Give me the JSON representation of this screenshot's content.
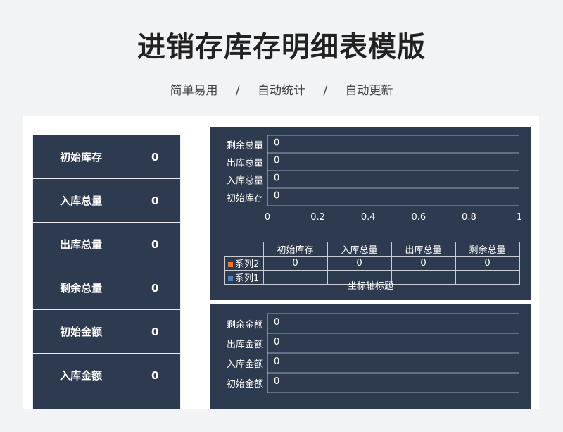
{
  "page": {
    "title": "进销存库存明细表模版",
    "tags": [
      "简单易用",
      "自动统计",
      "自动更新"
    ],
    "separator": "/"
  },
  "summary": {
    "rows": [
      {
        "label": "初始库存",
        "value": "0"
      },
      {
        "label": "入库总量",
        "value": "0"
      },
      {
        "label": "出库总量",
        "value": "0"
      },
      {
        "label": "剩余总量",
        "value": "0"
      },
      {
        "label": "初始金额",
        "value": "0"
      },
      {
        "label": "入库金额",
        "value": "0"
      }
    ]
  },
  "chart_data": [
    {
      "type": "bar",
      "orientation": "horizontal",
      "categories": [
        "初始库存",
        "入库总量",
        "出库总量",
        "剩余总量"
      ],
      "series": [
        {
          "name": "系列2",
          "values": [
            0,
            0,
            0,
            0
          ],
          "color": "#e07b39"
        },
        {
          "name": "系列1",
          "values": [
            null,
            null,
            null,
            null
          ],
          "color": "#4f81bd"
        }
      ],
      "xlim": [
        0,
        1
      ],
      "xticks": [
        "0",
        "0.2",
        "0.4",
        "0.6",
        "0.8",
        "1"
      ],
      "data_labels": [
        "0",
        "0",
        "0",
        "0"
      ],
      "xlabel": "坐标轴标题",
      "data_table": true
    },
    {
      "type": "bar",
      "orientation": "horizontal",
      "categories": [
        "初始金额",
        "入库金额",
        "出库金额",
        "剩余金额"
      ],
      "series": [
        {
          "values": [
            0,
            0,
            0,
            0
          ]
        }
      ],
      "data_labels": [
        "0",
        "0",
        "0",
        "0"
      ]
    }
  ]
}
